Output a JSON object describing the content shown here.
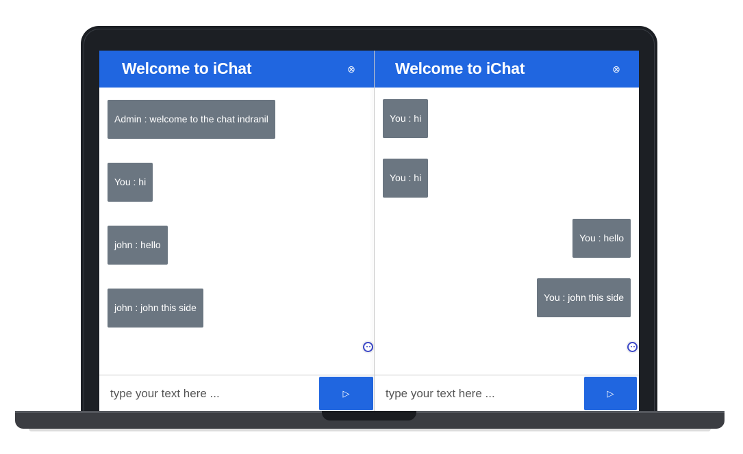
{
  "chat_window_left": {
    "header_title": "Welcome to iChat",
    "messages": [
      {
        "text": "Admin : welcome to the chat indranil"
      },
      {
        "text": "You : hi"
      },
      {
        "text": "john : hello"
      },
      {
        "text": "john : john this side"
      }
    ],
    "input_placeholder": "type your text here ...",
    "send_icon": "▷",
    "close_icon": "⊗"
  },
  "chat_window_right": {
    "header_title": "Welcome to iChat",
    "messages": [
      {
        "text": "You : hi"
      },
      {
        "text": "You : hi"
      },
      {
        "text": "You : hello"
      },
      {
        "text": "You : john this side"
      }
    ],
    "input_placeholder": "type your text here ...",
    "send_icon": "▷",
    "close_icon": "⊗"
  },
  "colors": {
    "header": "#2066e0",
    "message_bubble": "#6b7681",
    "send_button": "#2066e0",
    "laptop_frame": "#1c1f24"
  }
}
